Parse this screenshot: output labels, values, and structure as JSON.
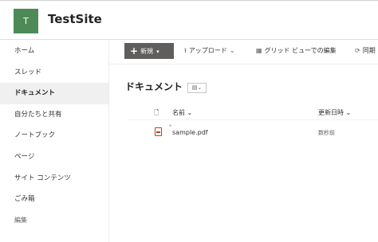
{
  "header": {
    "logo_letter": "T",
    "site_title": "TestSite"
  },
  "nav": {
    "items": [
      "ホーム",
      "スレッド",
      "ドキュメント",
      "自分たちと共有",
      "ノートブック",
      "ページ",
      "サイト コンテンツ",
      "ごみ箱"
    ],
    "active_index": 2,
    "edit_label": "編集"
  },
  "commands": {
    "new_label": "新規",
    "upload_label": "アップロード",
    "grid_label": "グリッド ビューでの編集",
    "sync_label": "同期"
  },
  "library": {
    "title": "ドキュメント",
    "columns": {
      "name": "名前",
      "modified": "更新日時"
    },
    "files": [
      {
        "name": "sample.pdf",
        "modified": "数秒前"
      }
    ]
  },
  "colors": {
    "logo_bg": "#4d8a57",
    "new_button_bg": "#605e5c",
    "pdf_icon": "#c43e1c"
  }
}
